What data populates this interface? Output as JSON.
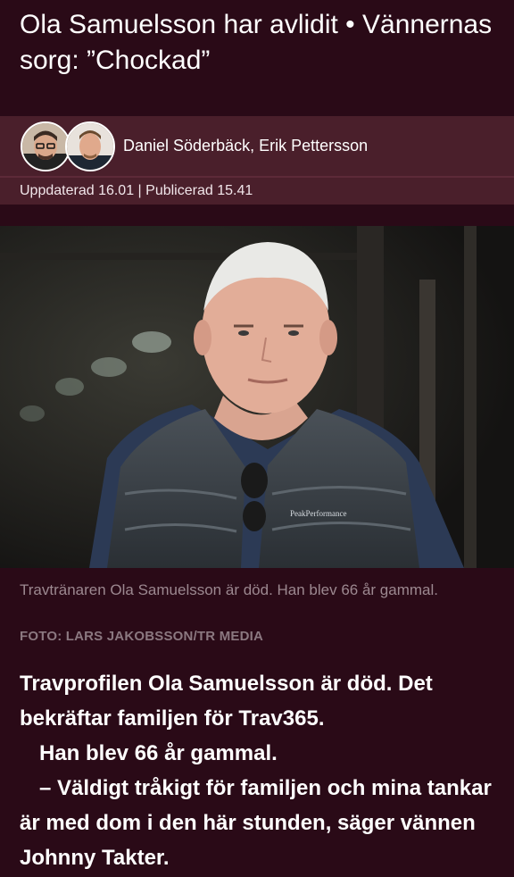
{
  "article": {
    "headline": "Ola Samuelsson har avlidit • Vännernas sorg: ”Chockad”",
    "authors": "Daniel Söderbäck, Erik Pettersson",
    "meta": "Uppdaterad 16.01 | Publicerad 15.41",
    "photo": {
      "jacket_brand": "PeakPerformance"
    },
    "caption": "Travtränaren Ola Samuelsson är död. Han blev 66 år gammal.",
    "credit": "FOTO: LARS JAKOBSSON/TR MEDIA",
    "paragraphs": [
      "Travprofilen Ola Samuelsson är död. Det bekräftar familjen för Trav365.",
      "Han blev 66 år gammal.",
      "– Väldigt tråkigt för familjen och mina tankar är med dom i den här stunden, säger vännen Johnny Takter."
    ]
  },
  "colors": {
    "background": "#2a0a17",
    "byline_bar": "#4a1f2b",
    "caption_text": "#9c8890"
  }
}
